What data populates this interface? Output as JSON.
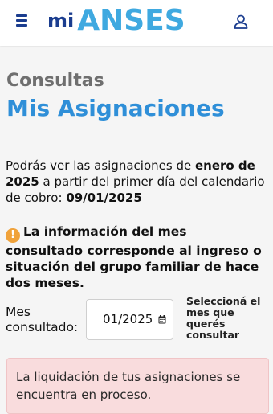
{
  "header": {
    "logo_prefix": "mi",
    "logo_name": "ANSES",
    "colors": {
      "logo_dark": "#1b3d8f",
      "logo_light": "#3fa9e0"
    }
  },
  "page": {
    "section_label": "Consultas",
    "title": "Mis Asignaciones",
    "title_color": "#2f8fd8"
  },
  "info": {
    "part1": "Podrás ver las asignaciones de ",
    "month_year": "enero de 2025",
    "part2": " a partir del primer día del calendario de cobro: ",
    "date": "09/01/2025"
  },
  "warning": {
    "icon": "exclamation-icon",
    "text": "La información del mes consultado corresponde al ingreso o situación del grupo familiar de hace dos meses."
  },
  "month_selector": {
    "label": "Mes consultado:",
    "value": "01/2025",
    "hint": "Seleccioná el mes que querés consultar"
  },
  "alert": {
    "text": "La liquidación de tus asignaciones se encuentra en proceso.",
    "background": "#f9dcdd"
  }
}
